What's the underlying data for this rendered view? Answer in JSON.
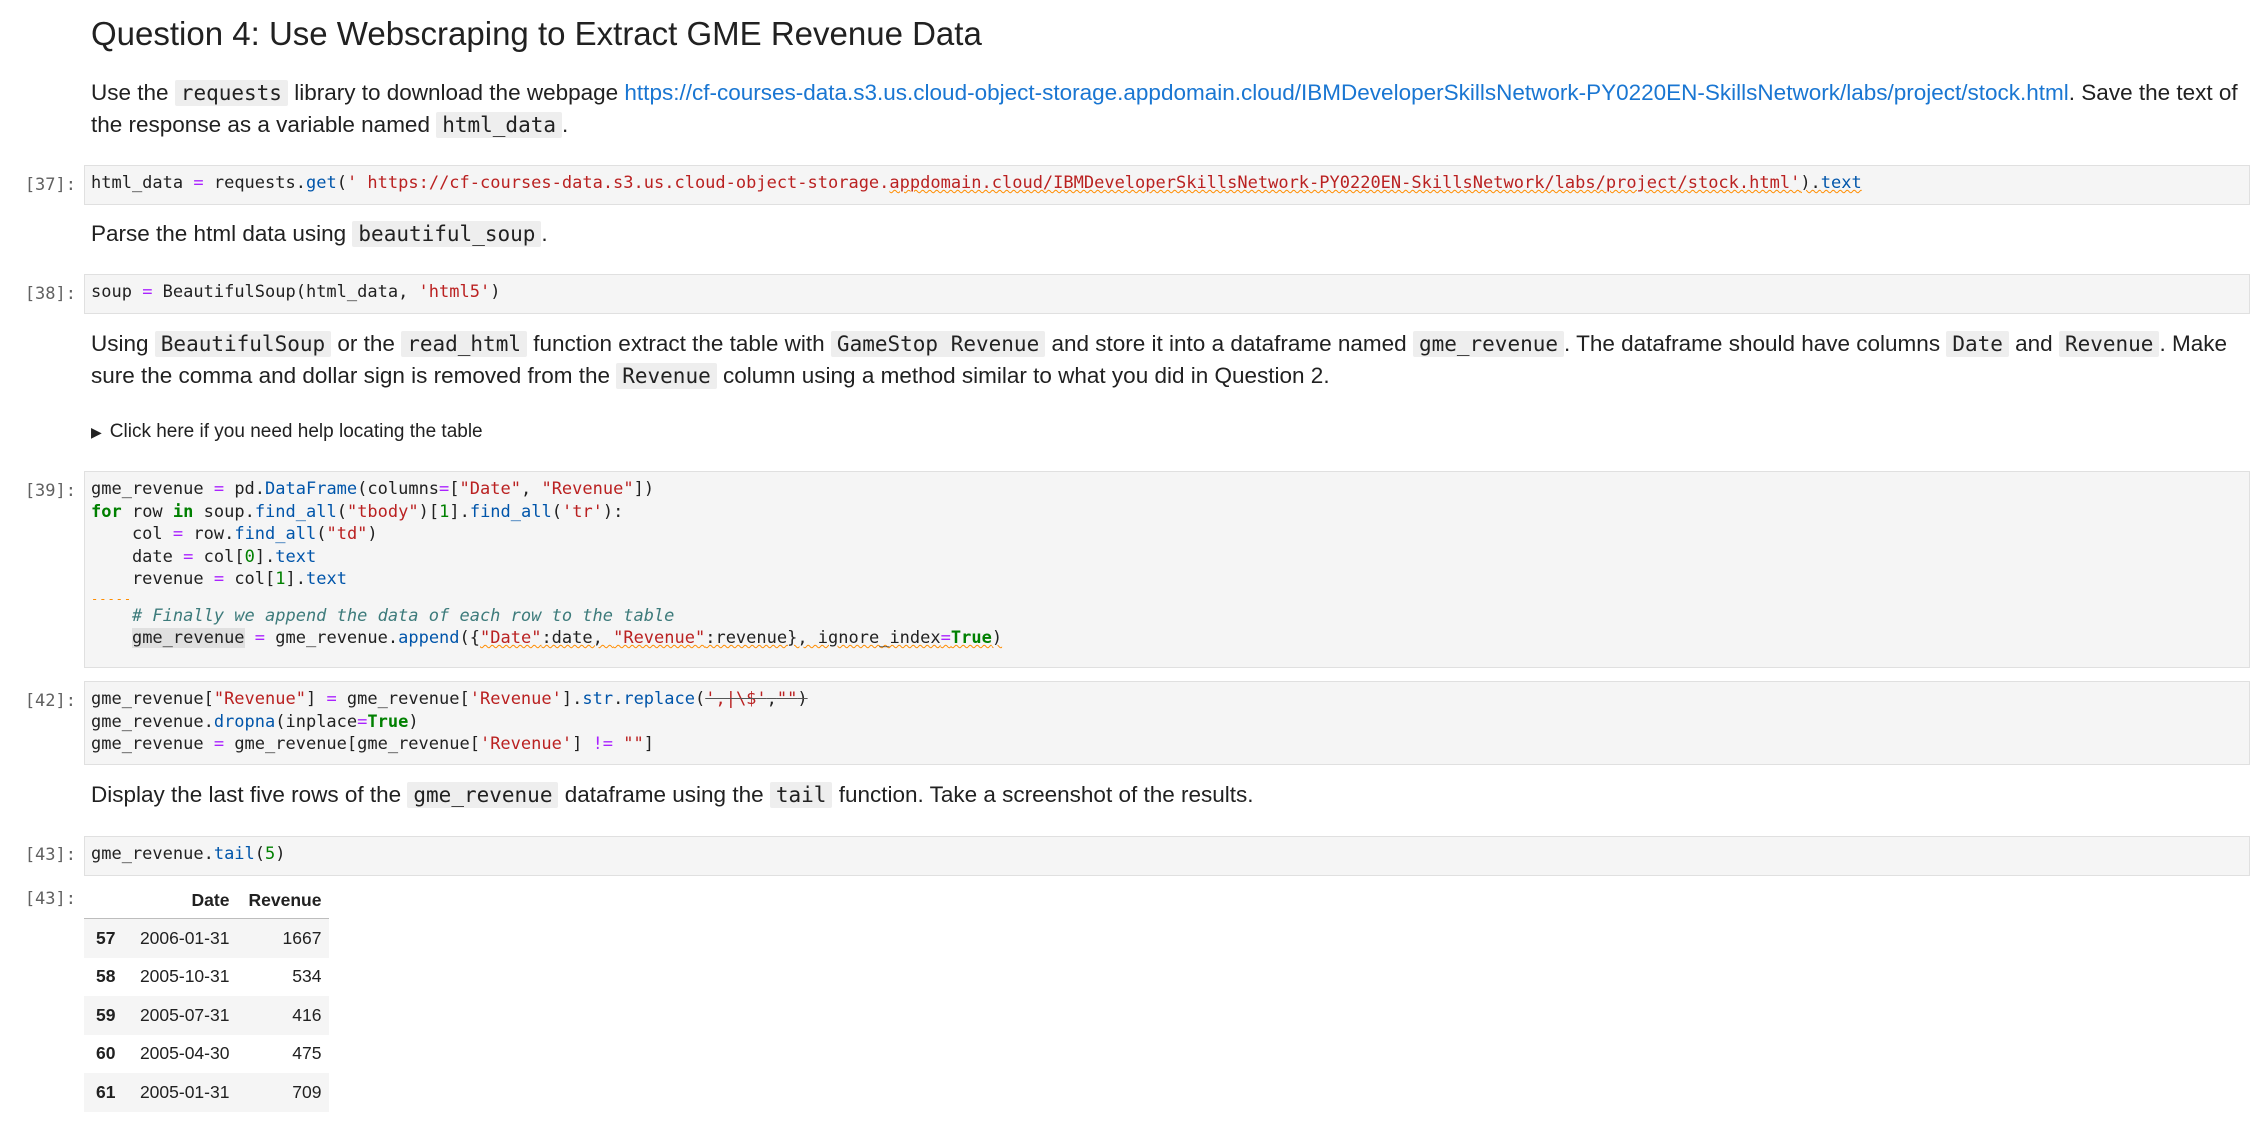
{
  "heading": "Question 4: Use Webscraping to Extract GME Revenue Data",
  "intro": {
    "t1": "Use the ",
    "c1": "requests",
    "t2": " library to download the webpage ",
    "link": "https://cf-courses-data.s3.us.cloud-object-storage.appdomain.cloud/IBMDeveloperSkillsNetwork-PY0220EN-SkillsNetwork/labs/project/stock.html",
    "t3": ". Save the text of the response as a variable named ",
    "c2": "html_data",
    "t4": "."
  },
  "parse_text": {
    "t1": "Parse the html data using ",
    "c1": "beautiful_soup",
    "t2": "."
  },
  "extract_text": {
    "t1": "Using ",
    "c1": "BeautifulSoup",
    "t2": " or the ",
    "c2": "read_html",
    "t3": " function extract the table with ",
    "c3": "GameStop Revenue",
    "t4": " and store it into a dataframe named ",
    "c4": "gme_revenue",
    "t5": ". The dataframe should have columns ",
    "c5": "Date",
    "t6": " and ",
    "c6": "Revenue",
    "t7": ". Make sure the comma and dollar sign is removed from the ",
    "c7": "Revenue",
    "t8": " column using a method similar to what you did in Question 2."
  },
  "details_summary": "Click here if you need help locating the table",
  "display_text": {
    "t1": "Display the last five rows of the ",
    "c1": "gme_revenue",
    "t2": " dataframe using the ",
    "c2": "tail",
    "t3": " function. Take a screenshot of the results."
  },
  "prompts": {
    "c37": "[37]:",
    "c38": "[38]:",
    "c39": "[39]:",
    "c42": "[42]:",
    "c43": "[43]:",
    "o43": "[43]:"
  },
  "code": {
    "c37": {
      "a": "html_data",
      "b": " = ",
      "c": "requests",
      "d": ".",
      "e": "get",
      "f": "(",
      "g": "' https://cf-courses-data.s3.us.cloud-object-storage.",
      "h": "appdomain.cloud/IBMDeveloperSkillsNetwork-PY0220EN-SkillsNetwork/labs/project/stock.html'",
      "i": ").",
      "j": "text"
    },
    "c38": {
      "a": "soup",
      "b": " = ",
      "c": "BeautifulSoup(html_data, ",
      "d": "'html5'",
      "e": ")"
    },
    "c39": {
      "l1a": "gme_revenue",
      "l1b": " = ",
      "l1c": "pd.",
      "l1d": "DataFrame",
      "l1e": "(columns",
      "l1f": "=",
      "l1g": "[",
      "l1h": "\"Date\"",
      "l1i": ", ",
      "l1j": "\"Revenue\"",
      "l1k": "])",
      "l2a": "for",
      "l2b": " row ",
      "l2c": "in",
      "l2d": " soup.",
      "l2e": "find_all",
      "l2f": "(",
      "l2g": "\"tbody\"",
      "l2h": ")[",
      "l2i": "1",
      "l2j": "].",
      "l2k": "find_all",
      "l2l": "(",
      "l2m": "'tr'",
      "l2n": "):",
      "l3a": "    col ",
      "l3b": "=",
      "l3c": " row.",
      "l3d": "find_all",
      "l3e": "(",
      "l3f": "\"td\"",
      "l3g": ")",
      "l4a": "    date ",
      "l4b": "=",
      "l4c": " col[",
      "l4d": "0",
      "l4e": "].",
      "l4f": "text",
      "l5a": "    revenue ",
      "l5b": "=",
      "l5c": " col[",
      "l5d": "1",
      "l5e": "].",
      "l5f": "text",
      "dashes": "-----",
      "l7a": "    ",
      "l7b": "# Finally we append the data of each row to the table",
      "l8a": "    ",
      "l8b": "gme_revenue",
      "l8c": " ",
      "l8d": "=",
      "l8e": " gme_revenue.",
      "l8f": "append",
      "l8g": "({",
      "l8h": "\"Date\"",
      "l8i": ":date, ",
      "l8j": "\"Revenue\"",
      "l8k": ":revenue}, ignore_index",
      "l8l": "=",
      "l8m": "True",
      "l8n": ")"
    },
    "c42": {
      "l1a": "gme_revenue[",
      "l1b": "\"Revenue\"",
      "l1c": "] ",
      "l1d": "=",
      "l1e": " gme_revenue[",
      "l1f": "'Revenue'",
      "l1g": "].",
      "l1h": "str",
      "l1i": ".",
      "l1j": "replace",
      "l1k": "(",
      "l1l": "',|\\$'",
      "l1m": ",",
      "l1n": "\"\"",
      "l1o": ")",
      "l2a": "gme_revenue.",
      "l2b": "dropna",
      "l2c": "(inplace",
      "l2d": "=",
      "l2e": "True",
      "l2f": ")",
      "l3a": "gme_revenue ",
      "l3b": "=",
      "l3c": " gme_revenue[gme_revenue[",
      "l3d": "'Revenue'",
      "l3e": "] ",
      "l3f": "!=",
      "l3g": " ",
      "l3h": "\"\"",
      "l3i": "]"
    },
    "c43": {
      "a": "gme_revenue.",
      "b": "tail",
      "c": "(",
      "d": "5",
      "e": ")"
    }
  },
  "table": {
    "headers": [
      "",
      "Date",
      "Revenue"
    ],
    "rows": [
      [
        "57",
        "2006-01-31",
        "1667"
      ],
      [
        "58",
        "2005-10-31",
        "534"
      ],
      [
        "59",
        "2005-07-31",
        "416"
      ],
      [
        "60",
        "2005-04-30",
        "475"
      ],
      [
        "61",
        "2005-01-31",
        "709"
      ]
    ]
  },
  "colors": {
    "keyword": "#008000",
    "string": "#ba2121",
    "operator": "#aa22ff",
    "attribute": "#0055aa",
    "comment": "#3d7b7b",
    "link": "#1976d2",
    "cell_bg": "#f5f5f5"
  }
}
